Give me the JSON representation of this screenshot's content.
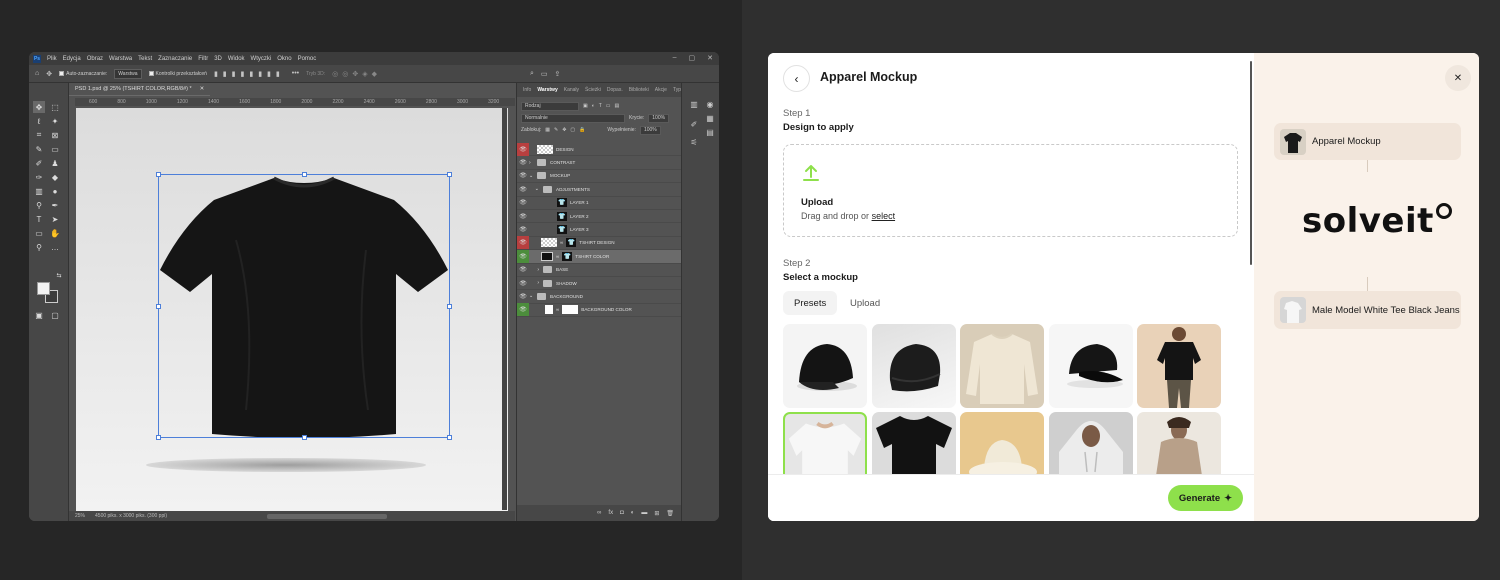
{
  "photoshop": {
    "menu": [
      "Plik",
      "Edycja",
      "Obraz",
      "Warstwa",
      "Tekst",
      "Zaznaczanie",
      "Filtr",
      "3D",
      "Widok",
      "Wtyczki",
      "Okno",
      "Pomoc"
    ],
    "options": {
      "auto_select": "Auto-zaznaczanie:",
      "target": "Warstwa",
      "transform_controls": "Kontrolki przekształceń",
      "mode_3d": "Tryb 3D:"
    },
    "document_tab": "PSD 1.psd @ 25% (TSHIRT COLOR,RGB/8#) *",
    "ruler": [
      "600",
      "800",
      "1000",
      "1200",
      "1400",
      "1600",
      "1800",
      "2000",
      "2200",
      "2400",
      "2600",
      "2800",
      "3000",
      "3200",
      "3400",
      "3600",
      "3800"
    ],
    "status": {
      "zoom": "25%",
      "size": "4500 piks. x 3000 piks. (300 ppi)"
    },
    "panel_tabs": [
      "Info",
      "Warstwy",
      "Kanały",
      "Ścieżki",
      "Dopas.",
      "Biblioteki",
      "Akcje",
      "Type"
    ],
    "layer_filter": "Rodzaj",
    "blend_mode": "Normalnie",
    "opacity_label": "Krycie:",
    "opacity_value": "100%",
    "lock_label": "Zablokuj:",
    "fill_label": "Wypełnienie:",
    "fill_value": "100%",
    "layers": [
      {
        "name": "DESIGN",
        "kind": "smart",
        "eye": "red"
      },
      {
        "name": "CONTRAST",
        "kind": "folder",
        "eye": "normal"
      },
      {
        "name": "MOCKUP",
        "kind": "folder",
        "eye": "normal"
      },
      {
        "name": "ADJUSTMENTS",
        "kind": "folder",
        "eye": "normal"
      },
      {
        "name": "LAYER 1",
        "kind": "layer",
        "eye": "normal"
      },
      {
        "name": "LAYER 2",
        "kind": "layer",
        "eye": "normal"
      },
      {
        "name": "LAYER 3",
        "kind": "layer",
        "eye": "normal"
      },
      {
        "name": "TSHIRT DESIGN",
        "kind": "masked",
        "eye": "red"
      },
      {
        "name": "TSHIRT COLOR",
        "kind": "masked",
        "eye": "green"
      },
      {
        "name": "BASE",
        "kind": "folder",
        "eye": "normal"
      },
      {
        "name": "SHADOW",
        "kind": "folder",
        "eye": "normal"
      },
      {
        "name": "BACKGROUND",
        "kind": "folder",
        "eye": "normal"
      },
      {
        "name": "BACKGROUND COLOR",
        "kind": "masked",
        "eye": "green"
      }
    ]
  },
  "mockup": {
    "title": "Apparel Mockup",
    "step1_label": "Step 1",
    "step1_title": "Design to apply",
    "upload_title": "Upload",
    "upload_sub": "Drag and drop or",
    "upload_link": "select",
    "step2_label": "Step 2",
    "step2_title": "Select a mockup",
    "tabs": [
      "Presets",
      "Upload"
    ],
    "presets": [
      "black-cap",
      "black-beanie",
      "cream-sweatshirt",
      "black-snapback",
      "model-black-tee",
      "model-white-tee",
      "black-tee-flat",
      "cream-bucket-hat",
      "model-grey-hoodie",
      "model-beige-hoodie"
    ],
    "generate_label": "Generate",
    "accent": "#8ee04b",
    "flow": {
      "input_chip": "Apparel Mockup",
      "brand": "solveit",
      "output_chip": "Male Model White Tee Black Jeans"
    }
  }
}
